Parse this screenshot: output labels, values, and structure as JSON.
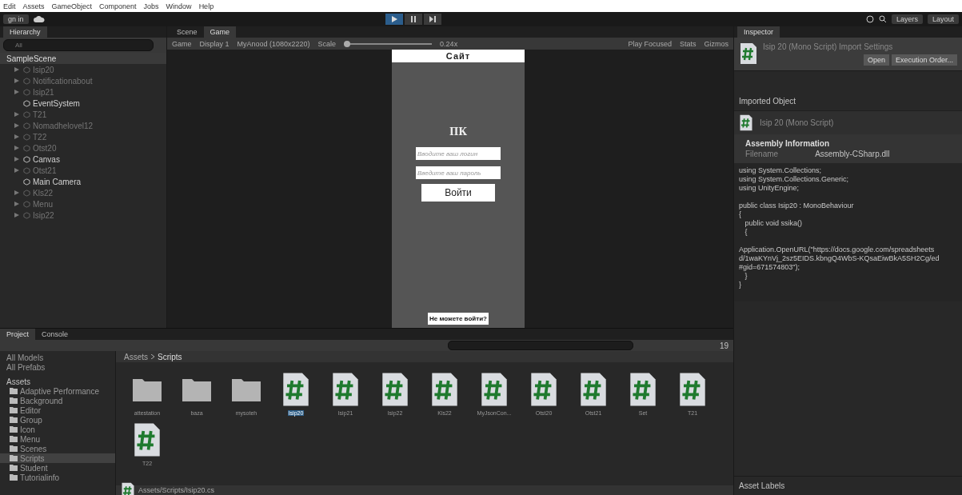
{
  "menu_bar": [
    "Edit",
    "Assets",
    "GameObject",
    "Component",
    "Jobs",
    "Window",
    "Help"
  ],
  "toolbar": {
    "account": "gn in",
    "right": [
      "Layers",
      "Layout"
    ]
  },
  "hierarchy": {
    "title": "Hierarchy",
    "search": {
      "placeholder": "All"
    },
    "scene": "SampleScene",
    "items": [
      {
        "name": "Isip20",
        "kind": "parent",
        "active": false
      },
      {
        "name": "Notificationabout",
        "kind": "parent",
        "active": false
      },
      {
        "name": "Isip21",
        "kind": "parent",
        "active": false
      },
      {
        "name": "EventSystem",
        "kind": "leaf",
        "active": true
      },
      {
        "name": "T21",
        "kind": "parent",
        "active": false
      },
      {
        "name": "Nomadhelovel12",
        "kind": "parent",
        "active": false
      },
      {
        "name": "T22",
        "kind": "parent",
        "active": false
      },
      {
        "name": "Otst20",
        "kind": "parent",
        "active": false
      },
      {
        "name": "Canvas",
        "kind": "parent",
        "active": true
      },
      {
        "name": "Otst21",
        "kind": "parent",
        "active": false
      },
      {
        "name": "Main Camera",
        "kind": "leaf",
        "active": true
      },
      {
        "name": "Kls22",
        "kind": "parent",
        "active": false
      },
      {
        "name": "Menu",
        "kind": "parent",
        "active": false
      },
      {
        "name": "Isip22",
        "kind": "parent",
        "active": false
      }
    ]
  },
  "view_tabs": [
    {
      "label": "Scene",
      "selected": false
    },
    {
      "label": "Game",
      "selected": true
    }
  ],
  "game_toolbar": {
    "mode": "Game",
    "display": "Display 1",
    "resolution": "MyAnood (1080x2220)",
    "scale_label": "Scale",
    "scale": "0.24x",
    "scale_slider": {
      "level": 0
    },
    "play_mode": "Play Focused",
    "stats": "Stats",
    "gizmos": "Gizmos"
  },
  "phone": {
    "header": "Сайт",
    "title": "ПК",
    "login": {
      "placeholder": "Вводите ваш логин"
    },
    "password": {
      "placeholder": "Введите ваш пароль"
    },
    "button": "Войти",
    "footer_link": "Не можете войти?"
  },
  "inspector": {
    "title": "Inspector",
    "header": "Isip 20 (Mono Script) Import Settings",
    "buttons": [
      "Open",
      "Execution Order..."
    ],
    "imported_label": "Imported Object",
    "imported_name": "Isip 20 (Mono Script)",
    "assembly_title": "Assembly Information",
    "filename_label": "Filename",
    "filename": "Assembly-CSharp.dll",
    "code_blocks": [
      [
        "using System.Collections;",
        "using System.Collections.Generic;",
        "using UnityEngine;"
      ],
      [
        "public class Isip20 : MonoBehaviour",
        "{",
        "   public void ssika()",
        "   {"
      ],
      [
        "Application.OpenURL(\"https://docs.google.com/spreadsheets",
        "d/1waKYnVj_2sz5EIDS.kbngQ4WbS-KQsaEiwBkA5SH2Cg/ed",
        "#gid=671574803\");",
        "   }",
        "}"
      ]
    ],
    "asset_labels": "Asset Labels"
  },
  "bottom_tabs": [
    {
      "label": "Project",
      "selected": true
    },
    {
      "label": "Console",
      "selected": false
    }
  ],
  "project": {
    "favorites": [
      "All Models",
      "All Prefabs"
    ],
    "root": "Assets",
    "folders": [
      {
        "name": "Adaptive Performance",
        "selected": false
      },
      {
        "name": "Background",
        "selected": false
      },
      {
        "name": "Editor",
        "selected": false
      },
      {
        "name": "Group",
        "selected": false
      },
      {
        "name": "Icon",
        "selected": false
      },
      {
        "name": "Menu",
        "selected": false
      },
      {
        "name": "Scenes",
        "selected": false
      },
      {
        "name": "Scripts",
        "selected": true
      },
      {
        "name": "Student",
        "selected": false
      },
      {
        "name": "Tutorialinfo",
        "selected": false
      }
    ],
    "breadcrumb": [
      "Assets",
      "Scripts"
    ],
    "count": "19",
    "assets": [
      {
        "name": "attestation",
        "kind": "folder",
        "selected": false
      },
      {
        "name": "baza",
        "kind": "folder",
        "selected": false
      },
      {
        "name": "mysoteh",
        "kind": "folder",
        "selected": false
      },
      {
        "name": "Isip20",
        "kind": "script",
        "selected": true
      },
      {
        "name": "Isip21",
        "kind": "script",
        "selected": false
      },
      {
        "name": "Isip22",
        "kind": "script",
        "selected": false
      },
      {
        "name": "Kls22",
        "kind": "script",
        "selected": false
      },
      {
        "name": "MyJsonCon...",
        "kind": "script",
        "selected": false
      },
      {
        "name": "Otst20",
        "kind": "script",
        "selected": false
      },
      {
        "name": "Otst21",
        "kind": "script",
        "selected": false
      },
      {
        "name": "Set",
        "kind": "script",
        "selected": false
      },
      {
        "name": "T21",
        "kind": "script",
        "selected": false
      },
      {
        "name": "T22",
        "kind": "script",
        "selected": false
      }
    ],
    "path": "Assets/Scripts/Isip20.cs"
  }
}
